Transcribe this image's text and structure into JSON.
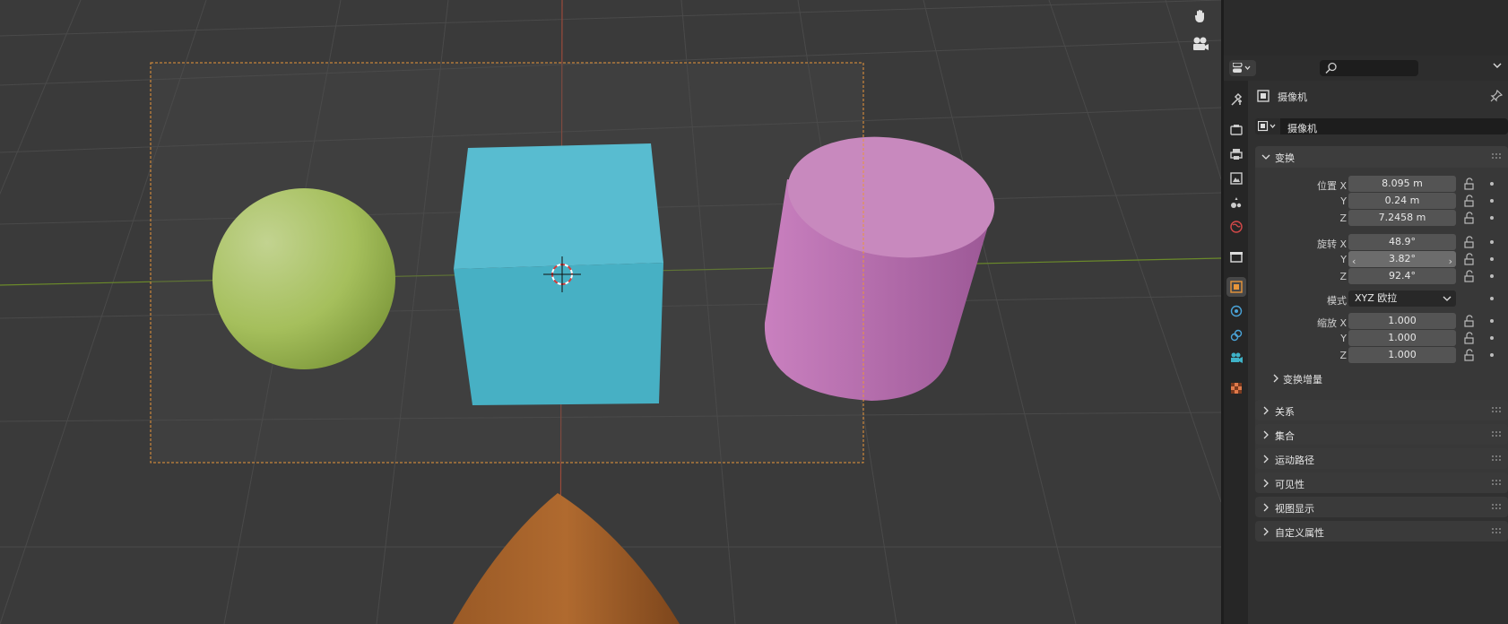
{
  "viewport": {
    "tool_icons": [
      "hand-pan-icon",
      "camera-view-icon"
    ]
  },
  "properties": {
    "header": {
      "editor_type_icon": "properties-editor-icon",
      "search_placeholder": ""
    },
    "tabs": [
      {
        "name": "tool-tab",
        "icon": "tool-icon"
      },
      {
        "name": "render-tab",
        "icon": "render-icon"
      },
      {
        "name": "output-tab",
        "icon": "output-icon"
      },
      {
        "name": "view-layer-tab",
        "icon": "view-layer-icon"
      },
      {
        "name": "scene-tab",
        "icon": "scene-icon"
      },
      {
        "name": "world-tab",
        "icon": "world-icon"
      },
      {
        "name": "collection-tab",
        "icon": "collection-icon"
      },
      {
        "name": "object-tab",
        "icon": "object-icon",
        "active": true
      },
      {
        "name": "physics-tab",
        "icon": "physics-icon"
      },
      {
        "name": "constraints-tab",
        "icon": "constraints-icon"
      },
      {
        "name": "object-data-tab",
        "icon": "camera-data-icon"
      },
      {
        "name": "texture-tab",
        "icon": "texture-icon"
      }
    ],
    "context": {
      "object_name": "摄像机"
    },
    "name_field": {
      "value": "摄像机"
    },
    "transform": {
      "title": "变换",
      "location": {
        "label_x": "位置 X",
        "label_y": "Y",
        "label_z": "Z",
        "x": "8.095 m",
        "y": "0.24 m",
        "z": "7.2458 m"
      },
      "rotation": {
        "label_x": "旋转 X",
        "label_y": "Y",
        "label_z": "Z",
        "x": "48.9°",
        "y": "3.82°",
        "z": "92.4°"
      },
      "mode": {
        "label": "模式",
        "value": "XYZ 欧拉"
      },
      "scale": {
        "label_x": "缩放 X",
        "label_y": "Y",
        "label_z": "Z",
        "x": "1.000",
        "y": "1.000",
        "z": "1.000"
      },
      "delta_title": "变换增量"
    },
    "panels": [
      "关系",
      "集合",
      "运动路径",
      "可见性",
      "视图显示",
      "自定义属性"
    ]
  },
  "colors": {
    "camera_frame": "#e8963a",
    "sphere": "#a9c25b",
    "cube": "#4cb7cc",
    "cylinder": "#c47ab8",
    "cone": "#a5612a",
    "active_tab": "#e8963a"
  }
}
